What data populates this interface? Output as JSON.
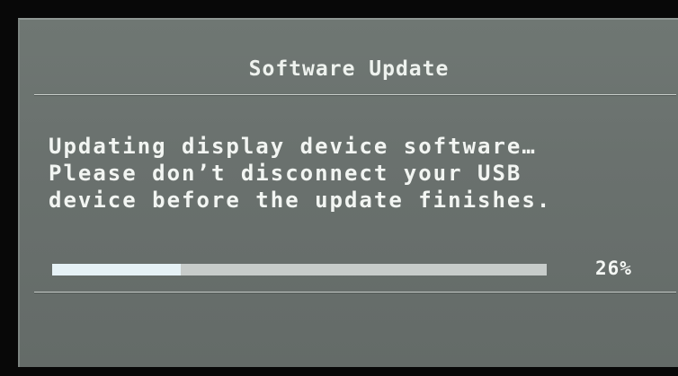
{
  "dialog": {
    "title": "Software Update",
    "message_lines": [
      "Updating display device software…",
      "Please don’t disconnect your USB",
      "device before the update finishes."
    ],
    "progress": {
      "value": 0.26,
      "label": "26%"
    }
  },
  "colors": {
    "panel": "#6c7470",
    "text": "#f2f5f2",
    "progress_fill": "#e6f2f6",
    "progress_track": "#c7ccca"
  }
}
